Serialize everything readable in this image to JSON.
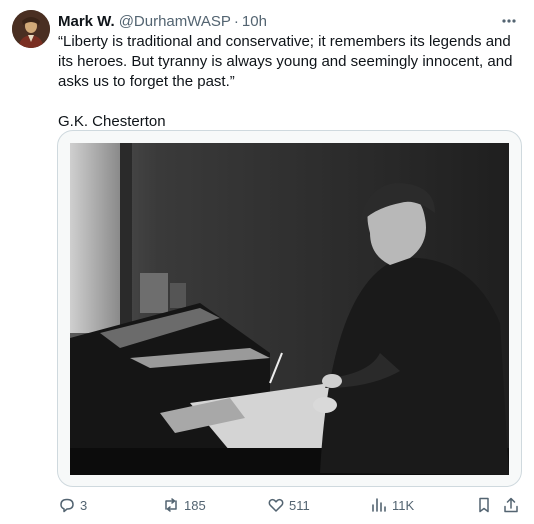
{
  "post": {
    "author_name": "Mark W.",
    "handle": "@DurhamWASP",
    "separator": "·",
    "time": "10h",
    "quote": "“Liberty is traditional and conservative; it remembers its legends and its heroes. But tyranny is always young and seemingly innocent, and asks us to forget the past.”",
    "attribution": "G.K. Chesterton"
  },
  "actions": {
    "replies": "3",
    "reposts": "185",
    "likes": "511",
    "views": "11K"
  },
  "icons": [
    "more-icon",
    "reply-icon",
    "repost-icon",
    "like-icon",
    "views-icon",
    "bookmark-icon",
    "share-icon"
  ],
  "colors": {
    "text": "#0f1419",
    "muted": "#536471",
    "border": "#cfd9de"
  }
}
